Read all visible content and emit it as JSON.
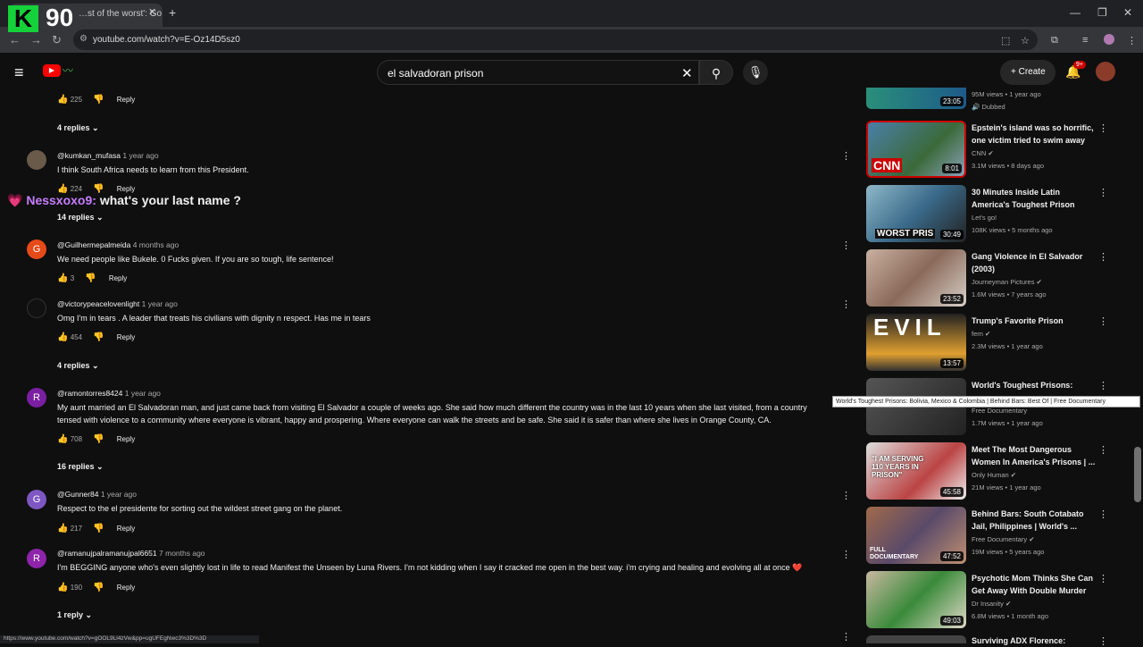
{
  "browser": {
    "tab_title": "…st of the worst': Go in",
    "url": "youtube.com/watch?v=E-Oz14D5sz0",
    "status_url": "https://www.youtube.com/watch?v=gOOL9Ll4zVw&pp=ugUFEgNwc3%3D%3D"
  },
  "overlay": {
    "logo_letter": "K",
    "logo_number": "90"
  },
  "chat_overlay": {
    "user": "Nessxoxo9:",
    "message": "what's your last name ?"
  },
  "header": {
    "search_value": "el salvadoran prison",
    "create_label": "Create",
    "notif_badge": "9+"
  },
  "comments": [
    {
      "likes": "225",
      "reply": "Reply"
    },
    {
      "replies_label": "4 replies"
    },
    {
      "author": "@kumkan_mufasa",
      "age": "1 year ago",
      "text": "I think South Africa needs to learn from this President.",
      "likes": "224",
      "reply": "Reply",
      "replies_label": "14 replies"
    },
    {
      "author": "@Guilhermepalmeida",
      "age": "4 months ago",
      "avatar_letter": "G",
      "text": "We need people like Bukele. 0 Fucks given. If you are so tough, life sentence!",
      "likes": "3",
      "reply": "Reply"
    },
    {
      "author": "@victorypeacelovenlight",
      "age": "1 year ago",
      "text": "Omg I'm in tears .  A leader that treats his civilians with dignity n respect.  Has me in tears",
      "likes": "454",
      "reply": "Reply",
      "replies_label": "4 replies"
    },
    {
      "author": "@ramontorres8424",
      "age": "1 year ago",
      "avatar_letter": "R",
      "text1": "My aunt married an El Salvadoran man, and just came back from visiting El Salvador a couple of weeks ago. She said how much different the country was in the last 10 years when she last visited, from a country",
      "text2": "tensed with violence to a community where everyone is vibrant, happy and prospering. Where everyone can walk the streets and be safe. She said it is safer than where she lives in Orange County, CA.",
      "likes": "708",
      "reply": "Reply",
      "replies_label": "16 replies"
    },
    {
      "author": "@Gunner84",
      "age": "1 year ago",
      "avatar_letter": "G",
      "text": "Respect to the el presidente for sorting out the wildest street gang on the planet.",
      "likes": "217",
      "reply": "Reply"
    },
    {
      "author": "@ramanujpalramanujpal6651",
      "age": "7 months ago",
      "avatar_letter": "R",
      "text": "I'm BEGGING anyone who's even slightly lost in life to read Manifest the Unseen by Luna Rivers. I'm not kidding when I say it cracked me open in the best way. i'm crying and healing and evolving all at once ❤️",
      "likes": "190",
      "reply": "Reply",
      "replies_label": "1 reply"
    }
  ],
  "recommendations": [
    {
      "meta": "95M views • 1 year ago",
      "extra": "Dubbed",
      "duration": "23:05"
    },
    {
      "title": "Epstein's island was so horrific, one victim tried to swim away",
      "channel": "CNN",
      "meta": "3.1M views • 8 days ago",
      "duration": "8:01",
      "thumb_text": "CNN"
    },
    {
      "title": "30 Minutes Inside Latin America's Toughest Prison",
      "channel": "Let's go!",
      "meta": "108K views • 5 months ago",
      "duration": "30:49",
      "thumb_text": "WORST PRIS"
    },
    {
      "title": "Gang Violence in El Salvador (2003)",
      "channel": "Journeyman Pictures",
      "meta": "1.6M views • 7 years ago",
      "duration": "23:52"
    },
    {
      "title": "Trump's Favorite Prison",
      "channel": "fern",
      "meta": "2.3M views • 1 year ago",
      "duration": "13:57",
      "thumb_text": "EVIL"
    },
    {
      "title": "World's Toughest Prisons:",
      "channel": "Free Documentary",
      "meta": "1.7M views • 1 year ago",
      "tooltip": "World's Toughest Prisons: Bolivia, Mexico & Colombia | Behind Bars: Best Of | Free Documentary"
    },
    {
      "title": "Meet The Most Dangerous Women In America's Prisons | ...",
      "channel": "Only Human",
      "meta": "21M views • 1 year ago",
      "duration": "45:58",
      "thumb_text": "\"I AM SERVING 110 YEARS IN PRISON\""
    },
    {
      "title": "Behind Bars: South Cotabato Jail, Philippines | World's ...",
      "channel": "Free Documentary",
      "meta": "19M views • 5 years ago",
      "duration": "47:52",
      "thumb_text": "FULL DOCUMENTARY"
    },
    {
      "title": "Psychotic Mom Thinks She Can Get Away With Double Murder",
      "channel": "Dr Insanity",
      "meta": "6.8M views • 1 month ago",
      "duration": "49:03"
    },
    {
      "title": "Surviving ADX Florence:"
    }
  ]
}
